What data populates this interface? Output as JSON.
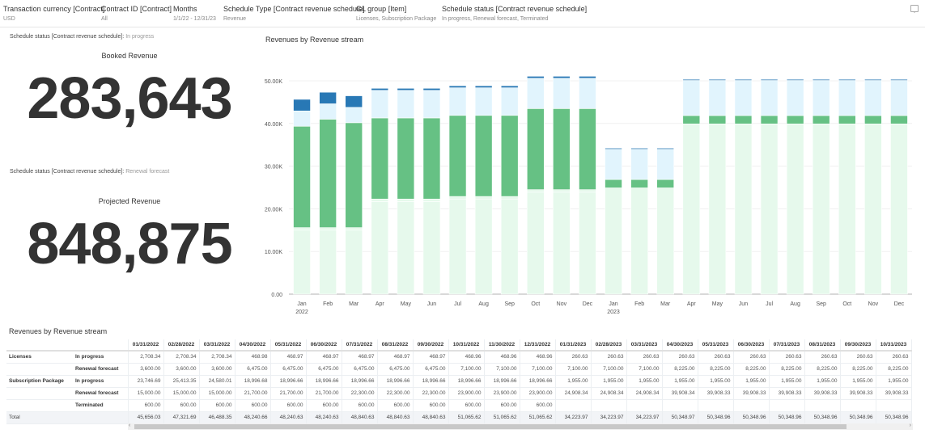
{
  "filters": [
    {
      "title": "Transaction currency [Contract]",
      "value": "USD"
    },
    {
      "title": "Contract ID [Contract]",
      "value": "All"
    },
    {
      "title": "Months",
      "value": "1/1/22 - 12/31/23"
    },
    {
      "title": "Schedule Type [Contract revenue schedule]",
      "value": "Revenue"
    },
    {
      "title": "GL group [Item]",
      "value": "Licenses, Subscription Package"
    },
    {
      "title": "Schedule status [Contract revenue schedule]",
      "value": "In progress, Renewal forecast, Terminated"
    }
  ],
  "comment_icon": "comment-icon",
  "kpis": [
    {
      "filter_label": "Schedule status [Contract revenue schedule]:",
      "filter_value": "In progress",
      "title": "Booked Revenue",
      "value": "283,643"
    },
    {
      "filter_label": "Schedule status [Contract revenue schedule]:",
      "filter_value": "Renewal forecast",
      "title": "Projected Revenue",
      "value": "848,875"
    }
  ],
  "chart_data": {
    "type": "bar",
    "stacked": true,
    "title": "Revenues by Revenue stream",
    "categories": [
      "Jan",
      "Feb",
      "Mar",
      "Apr",
      "May",
      "Jun",
      "Jul",
      "Aug",
      "Sep",
      "Oct",
      "Nov",
      "Dec",
      "Jan",
      "Feb",
      "Mar",
      "Apr",
      "May",
      "Jun",
      "Jul",
      "Aug",
      "Sep",
      "Oct",
      "Nov",
      "Dec"
    ],
    "year_labels": {
      "0": "2022",
      "12": "2023"
    },
    "yticks": [
      "0.00",
      "10.00K",
      "20.00K",
      "30.00K",
      "40.00K",
      "50.00K"
    ],
    "ylim": [
      0,
      50000
    ],
    "grid": true,
    "series": [
      {
        "color": "#e6f9ec",
        "values": [
          15000,
          15000,
          15000,
          21700,
          21700,
          21700,
          22300,
          22300,
          22300,
          23900,
          23900,
          23900,
          24908.34,
          24908.34,
          24908.34,
          39908.34,
          39908.33,
          39908.33,
          39908.33,
          39908.33,
          39908.33,
          39908.33,
          39908.33,
          39908.33
        ]
      },
      {
        "color": "#e6f9ec",
        "values": [
          600,
          600,
          600,
          600,
          600,
          600,
          600,
          600,
          600,
          600,
          600,
          600,
          0,
          0,
          0,
          0,
          0,
          0,
          0,
          0,
          0,
          0,
          0,
          0
        ]
      },
      {
        "color": "#66c184",
        "values": [
          23746.69,
          25413.35,
          24580.01,
          18996.68,
          18996.66,
          18996.66,
          18996.66,
          18996.66,
          18996.66,
          18996.66,
          18996.66,
          18996.66,
          1955,
          1955,
          1955,
          1955,
          1955,
          1955,
          1955,
          1955,
          1955,
          1955,
          1955,
          1955
        ]
      },
      {
        "color": "#e1f4fd",
        "values": [
          3600,
          3600,
          3600,
          6475,
          6475,
          6475,
          6475,
          6475,
          6475,
          7100,
          7100,
          7100,
          7100,
          7100,
          7100,
          8225,
          8225,
          8225,
          8225,
          8225,
          8225,
          8225,
          8225,
          8225
        ]
      },
      {
        "color": "#2878b5",
        "values": [
          2708.34,
          2708.34,
          2708.34,
          468.98,
          468.97,
          468.97,
          468.97,
          468.97,
          468.97,
          468.96,
          468.96,
          468.96,
          260.63,
          260.63,
          260.63,
          260.63,
          260.63,
          260.63,
          260.63,
          260.63,
          260.63,
          260.63,
          260.63,
          260.63
        ]
      }
    ]
  },
  "table": {
    "title": "Revenues by Revenue stream",
    "columns": [
      "01/31/2022",
      "02/28/2022",
      "03/31/2022",
      "04/30/2022",
      "05/31/2022",
      "06/30/2022",
      "07/31/2022",
      "08/31/2022",
      "09/30/2022",
      "10/31/2022",
      "11/30/2022",
      "12/31/2022",
      "01/31/2023",
      "02/28/2023",
      "03/31/2023",
      "04/30/2023",
      "05/31/2023",
      "06/30/2023",
      "07/31/2023",
      "08/31/2023",
      "09/30/2023",
      "10/31/2023"
    ],
    "rows": [
      {
        "group": "Licenses",
        "status": "In progress",
        "values": [
          "2,708.34",
          "2,708.34",
          "2,708.34",
          "468.98",
          "468.97",
          "468.97",
          "468.97",
          "468.97",
          "468.97",
          "468.96",
          "468.96",
          "468.96",
          "260.63",
          "260.63",
          "260.63",
          "260.63",
          "260.63",
          "260.63",
          "260.63",
          "260.63",
          "260.63",
          "260.63"
        ]
      },
      {
        "group": "",
        "status": "Renewal forecast",
        "values": [
          "3,600.00",
          "3,600.00",
          "3,600.00",
          "6,475.00",
          "6,475.00",
          "6,475.00",
          "6,475.00",
          "6,475.00",
          "6,475.00",
          "7,100.00",
          "7,100.00",
          "7,100.00",
          "7,100.00",
          "7,100.00",
          "7,100.00",
          "8,225.00",
          "8,225.00",
          "8,225.00",
          "8,225.00",
          "8,225.00",
          "8,225.00",
          "8,225.00"
        ]
      },
      {
        "group": "Subscription Package",
        "status": "In progress",
        "values": [
          "23,746.69",
          "25,413.35",
          "24,580.01",
          "18,996.68",
          "18,996.66",
          "18,996.66",
          "18,996.66",
          "18,996.66",
          "18,996.66",
          "18,996.66",
          "18,996.66",
          "18,996.66",
          "1,955.00",
          "1,955.00",
          "1,955.00",
          "1,955.00",
          "1,955.00",
          "1,955.00",
          "1,955.00",
          "1,955.00",
          "1,955.00",
          "1,955.00"
        ]
      },
      {
        "group": "",
        "status": "Renewal forecast",
        "values": [
          "15,000.00",
          "15,000.00",
          "15,000.00",
          "21,700.00",
          "21,700.00",
          "21,700.00",
          "22,300.00",
          "22,300.00",
          "22,300.00",
          "23,900.00",
          "23,900.00",
          "23,900.00",
          "24,908.34",
          "24,908.34",
          "24,908.34",
          "39,908.34",
          "39,908.33",
          "39,908.33",
          "39,908.33",
          "39,908.33",
          "39,908.33",
          "39,908.33"
        ]
      },
      {
        "group": "",
        "status": "Terminated",
        "values": [
          "600.00",
          "600.00",
          "600.00",
          "600.00",
          "600.00",
          "600.00",
          "600.00",
          "600.00",
          "600.00",
          "600.00",
          "600.00",
          "600.00",
          "",
          "",
          "",
          "",
          "",
          "",
          "",
          "",
          "",
          ""
        ]
      }
    ],
    "total": {
      "label": "Total",
      "values": [
        "45,656.03",
        "47,321.69",
        "46,488.35",
        "48,240.66",
        "48,240.63",
        "48,240.63",
        "48,840.63",
        "48,840.63",
        "48,840.63",
        "51,065.62",
        "51,065.62",
        "51,065.62",
        "34,223.97",
        "34,223.97",
        "34,223.97",
        "50,348.97",
        "50,348.96",
        "50,348.96",
        "50,348.96",
        "50,348.96",
        "50,348.96",
        "50,348.96"
      ]
    }
  }
}
